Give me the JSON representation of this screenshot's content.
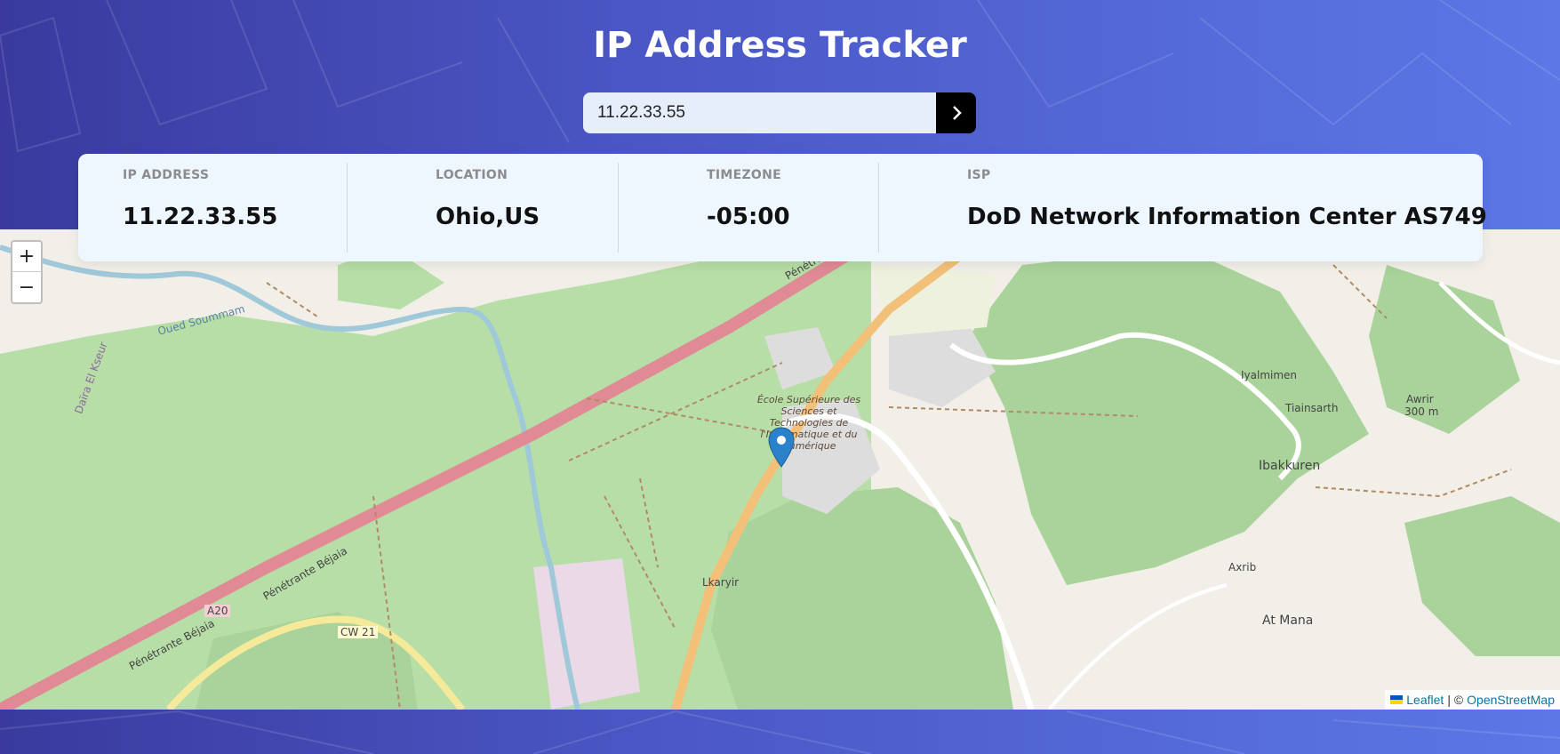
{
  "app": {
    "title": "IP Address Tracker"
  },
  "search": {
    "value": "11.22.33.55",
    "button_icon": "chevron-right-icon"
  },
  "info": {
    "ip": {
      "label": "IP ADDRESS",
      "value": "11.22.33.55"
    },
    "location": {
      "label": "LOCATION",
      "value": "Ohio,US"
    },
    "timezone": {
      "label": "TIMEZONE",
      "value": "-05:00"
    },
    "isp": {
      "label": "ISP",
      "value": "DoD Network Information Center AS749"
    }
  },
  "map": {
    "zoom_in": "+",
    "zoom_out": "−",
    "labels": {
      "oued": "Oued Soummam",
      "daira": "Daïra El Kseur",
      "penetrante1": "Pénétrante Béjaia",
      "penetrante2": "Pénétrante Béjaia",
      "a20": "A20",
      "cw21": "CW 21",
      "school": "École Supérieure des Sciences et Technologies de l'Informatique et du Numérique",
      "lkaryir": "Lkaryir",
      "iyalmimen": "Iyalmimen",
      "tiainsarth": "Tiainsarth",
      "awrir": "Awrir",
      "awrir_alt": "300 m",
      "ibakkuren": "Ibakkuren",
      "axrib": "Axrib",
      "atmana": "At Mana",
      "oued2": "Oued Soummam",
      "penetrante_top": "Pénétrante"
    },
    "attribution": {
      "leaflet": "Leaflet",
      "sep": "| ©",
      "osm": "OpenStreetMap"
    }
  },
  "colors": {
    "accent": "#000000",
    "card_bg": "#eef6ff",
    "forest": "#a9d39a",
    "road_pink": "#e08a96",
    "road_orange": "#f3c07a"
  }
}
